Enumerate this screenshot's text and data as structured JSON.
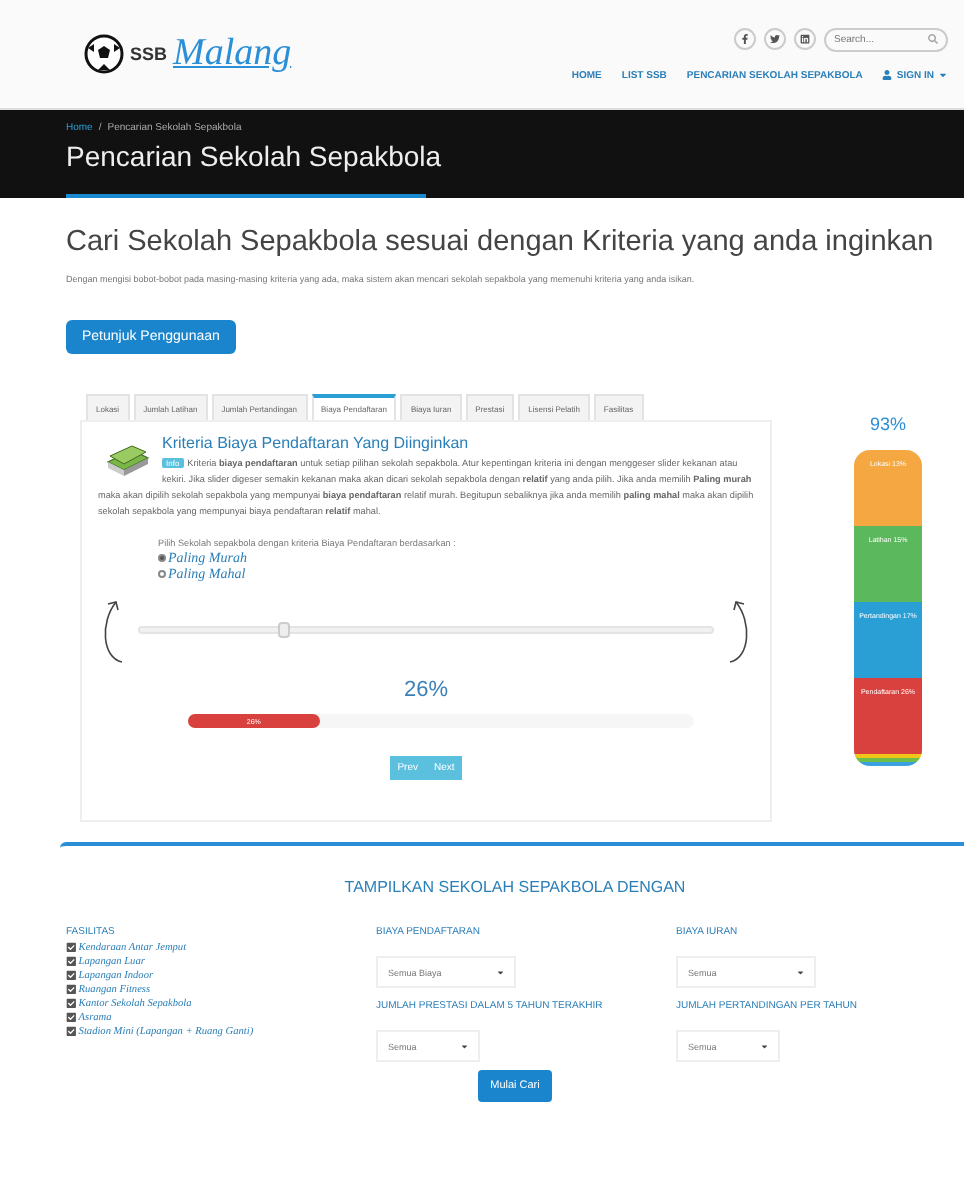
{
  "header": {
    "logo": {
      "prefix": "SSB",
      "name": "Malang"
    },
    "search": {
      "placeholder": "Search..."
    },
    "nav": [
      {
        "label": "HOME",
        "kind": "link"
      },
      {
        "label": "LIST SSB",
        "kind": "link"
      },
      {
        "label": "PENCARIAN SEKOLAH SEPAKBOLA",
        "kind": "link"
      },
      {
        "label": "SIGN IN",
        "kind": "account"
      }
    ]
  },
  "banner": {
    "breadcrumb": [
      {
        "label": "Home",
        "kind": "link"
      },
      {
        "label": "/",
        "kind": "separator"
      },
      {
        "label": "Pencarian Sekolah Sepakbola",
        "kind": "current"
      }
    ],
    "title": "Pencarian Sekolah Sepakbola"
  },
  "intro": {
    "heading": "Cari Sekolah Sepakbola sesuai dengan Kriteria yang anda inginkan",
    "description": "Dengan mengisi bobot-bobot pada masing-masing kriteria yang ada, maka sistem akan mencari sekolah sepakbola yang memenuhi kriteria yang anda isikan.",
    "button": "Petunjuk Penggunaan"
  },
  "tabs": [
    {
      "label": "Lokasi",
      "selected": false
    },
    {
      "label": "Jumlah Latihan",
      "selected": false
    },
    {
      "label": "Jumlah Pertandingan",
      "selected": false
    },
    {
      "label": "Biaya Pendaftaran",
      "selected": true
    },
    {
      "label": "Biaya Iuran",
      "selected": false
    },
    {
      "label": "Prestasi",
      "selected": false
    },
    {
      "label": "Lisensi Pelatih",
      "selected": false
    },
    {
      "label": "Fasilitas",
      "selected": false
    }
  ],
  "panel": {
    "heading": "Kriteria Biaya Pendaftaran Yang Diinginkan",
    "badge": "Info",
    "text": "Kriteria **biaya pendaftaran** untuk setiap pilihan sekolah sepakbola. Atur kepentingan kriteria ini dengan menggeser slider kekanan atau kekiri. Jika slider digeser semakin kekanan maka akan dicari sekolah sepakbola dengan **relatif** yang anda pilih. Jika anda memilih **Paling murah** maka akan dipilih sekolah sepakbola yang mempunyai **biaya pendaftaran** relatif murah. Begitupun sebaliknya jika anda memilih **paling mahal** maka akan dipilih sekolah sepakbola yang mempunyai biaya pendaftaran **relatif** mahal.",
    "prompt": "Pilih Sekolah sepakbola dengan kriteria Biaya Pendaftaran berdasarkan :",
    "options": [
      {
        "label": "Paling Murah",
        "selected": true
      },
      {
        "label": "Paling Mahal",
        "selected": false
      }
    ],
    "slider": {
      "level": 0.25
    },
    "percent": "26%",
    "progress": {
      "level": 0.26,
      "label": "26%"
    },
    "pager": [
      "Prev",
      "Next"
    ]
  },
  "weights": {
    "total": "93%",
    "segments": [
      {
        "label": "Lokasi 13%",
        "color": "#f5a742"
      },
      {
        "label": "Latihan 15%",
        "color": "#5cb85c"
      },
      {
        "label": "Pertandingan 17%",
        "color": "#2a9fd6"
      },
      {
        "label": "Pendaftaran 26%",
        "color": "#d9413e"
      },
      {
        "color": "#f0c419"
      },
      {
        "color": "#6cc04a"
      },
      {
        "color": "#3aa0e0"
      }
    ]
  },
  "filter": {
    "title": "TAMPILKAN SEKOLAH SEPAKBOLA DENGAN",
    "facilities": {
      "label": "FASILITAS",
      "items": [
        {
          "label": "Kendaraan Antar Jemput",
          "checked": true
        },
        {
          "label": "Lapangan Luar",
          "checked": true
        },
        {
          "label": "Lapangan Indoor",
          "checked": true
        },
        {
          "label": "Ruangan Fitness",
          "checked": true
        },
        {
          "label": "Kantor Sekolah Sepakbola",
          "checked": true
        },
        {
          "label": "Asrama",
          "checked": true
        },
        {
          "label": "Stadion Mini (Lapangan + Ruang Ganti)",
          "checked": true
        }
      ]
    },
    "selects": [
      {
        "label": "BIAYA PENDAFTARAN",
        "value": "Semua Biaya"
      },
      {
        "label": "JUMLAH PRESTASI DALAM 5 TAHUN TERAKHIR",
        "value": "Semua"
      },
      {
        "label": "BIAYA IURAN",
        "value": "Semua"
      },
      {
        "label": "JUMLAH PERTANDINGAN PER TAHUN",
        "value": "Semua"
      }
    ],
    "button": "Mulai Cari"
  }
}
